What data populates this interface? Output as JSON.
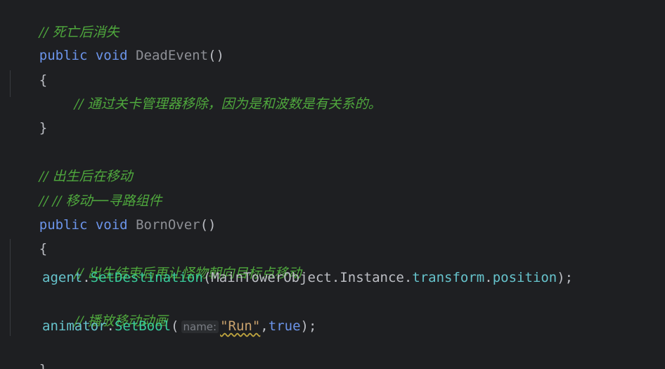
{
  "code": {
    "comment_dead": "// 死亡后消失",
    "kw_public": "public",
    "kw_void": "void",
    "fn_dead": "DeadEvent",
    "parens_empty": "()",
    "brace_open": "{",
    "brace_close": "}",
    "comment_remove": "// 通过关卡管理器移除，因为是和波数是有关系的。",
    "comment_born": "// 出生后在移动",
    "comment_move": "// // 移动──寻路组件",
    "fn_born": "BornOver",
    "comment_after_born": "// 出生结束后再让怪物朝向目标点移动",
    "agent": "agent",
    "set_destination": "SetDestination",
    "main_tower": "MainTowerObject",
    "instance": "Instance",
    "transform": "transform",
    "position": "position",
    "comment_anim": "// 播放移动动画",
    "animator": "animator",
    "set_bool": "SetBool",
    "hint_name": "name:",
    "str_run": "\"Run\"",
    "bool_true": "true",
    "dot": ".",
    "paren_open": "(",
    "close_paren_semi": ");",
    "comma": ","
  },
  "colors": {
    "background": "#1e1f22",
    "keyword": "#6c95eb",
    "comment": "#4fa83d",
    "method": "#39cc9b",
    "property": "#66c3cc",
    "string": "#c9a26d"
  }
}
